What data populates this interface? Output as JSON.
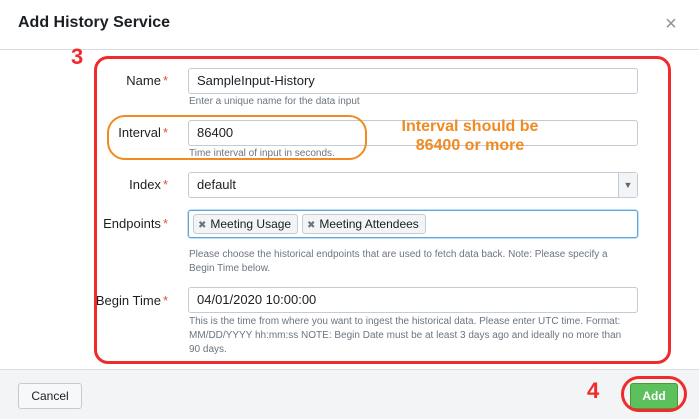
{
  "dialog": {
    "title": "Add History Service",
    "close_glyph": "×"
  },
  "form": {
    "name": {
      "label": "Name",
      "required": "*",
      "value": "SampleInput-History",
      "help": "Enter a unique name for the data input"
    },
    "interval": {
      "label": "Interval",
      "required": "*",
      "value": "86400",
      "help": "Time interval of input in seconds."
    },
    "index": {
      "label": "Index",
      "required": "*",
      "value": "default",
      "caret": "▼"
    },
    "endpoints": {
      "label": "Endpoints",
      "required": "*",
      "chips": [
        "Meeting Usage",
        "Meeting Attendees"
      ],
      "chip_remove": "✖",
      "help_line1": "Please choose the historical endpoints that are used to fetch data back. Note: Please specify a",
      "help_line2": "Begin Time below."
    },
    "begin_time": {
      "label": "Begin Time",
      "required": "*",
      "value": "04/01/2020 10:00:00",
      "help_line1": "This is the time from where you want to ingest the historical data. Please enter UTC time. Format:",
      "help_line2": "MM/DD/YYYY hh:mm:ss NOTE: Begin Date must be at least 3 days ago and ideally no more than",
      "help_line3": "90 days."
    }
  },
  "footer": {
    "cancel_label": "Cancel",
    "add_label": "Add"
  },
  "annotations": {
    "step3": "3",
    "step4": "4",
    "note_line1": "Interval should be",
    "note_line2": "86400 or more"
  },
  "colors": {
    "annotation_red": "#ef2b2b",
    "annotation_orange": "#f18a20",
    "add_green": "#5cc05c",
    "focus_blue": "#5aa6e0"
  }
}
